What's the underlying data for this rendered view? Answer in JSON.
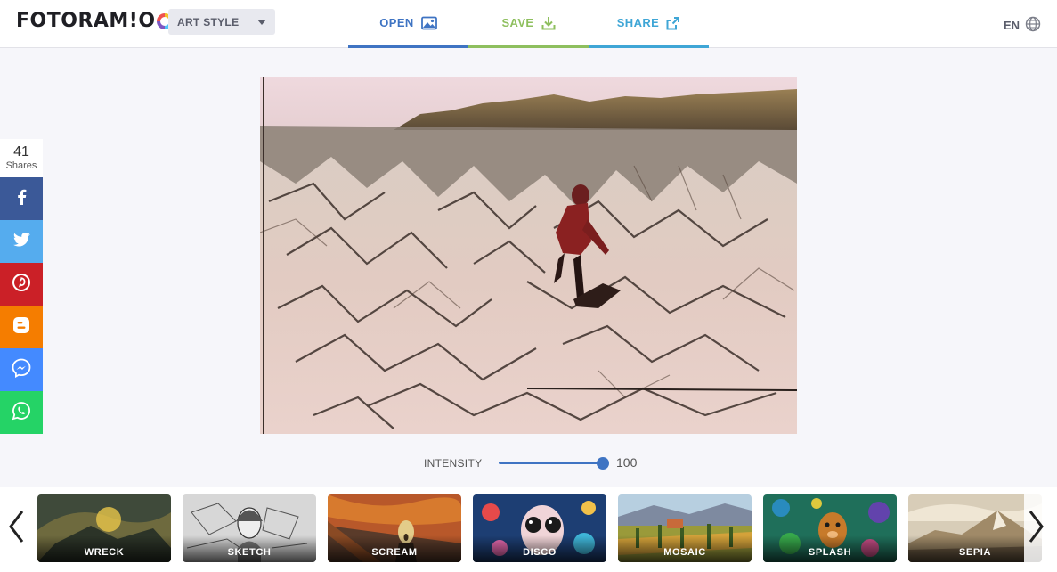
{
  "app": {
    "logo_text": "FOTORAM!O",
    "art_style_label": "ART STYLE"
  },
  "nav": {
    "open": "OPEN",
    "save": "SAVE",
    "share": "SHARE"
  },
  "language": "EN",
  "share_panel": {
    "count": "41",
    "count_label": "Shares",
    "networks": [
      "facebook",
      "twitter",
      "pinterest",
      "blogger",
      "messenger",
      "whatsapp"
    ]
  },
  "intensity": {
    "label": "INTENSITY",
    "value": "100",
    "level_percent": 100
  },
  "filters": [
    {
      "name": "WRECK"
    },
    {
      "name": "SKETCH"
    },
    {
      "name": "SCREAM"
    },
    {
      "name": "DISCO"
    },
    {
      "name": "MOSAIC"
    },
    {
      "name": "SPLASH"
    },
    {
      "name": "SEPIA"
    }
  ],
  "colors": {
    "open": "#3f74c3",
    "save": "#8ebf5e",
    "share": "#3fa6d6",
    "facebook": "#3b5998",
    "twitter": "#55acee",
    "pinterest": "#cb2027",
    "blogger": "#f57d00",
    "messenger": "#448aff",
    "whatsapp": "#25d366"
  },
  "icons": {
    "open": "image-icon",
    "save": "download-icon",
    "share": "share-icon",
    "language": "globe-icon",
    "prev": "chevron-left-icon",
    "next": "chevron-right-icon"
  }
}
